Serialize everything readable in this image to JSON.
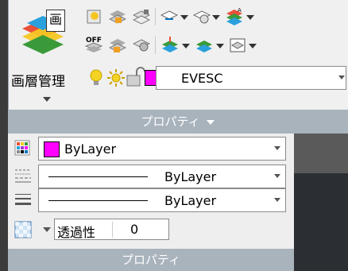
{
  "ribbon": {
    "layer_manager_label": "画層管理",
    "layer_current": "EVESC",
    "footer_label": "プロパティ",
    "layer_color": "#ff00ff"
  },
  "properties": {
    "color_value": "ByLayer",
    "color_swatch": "#ff00ff",
    "linetype_value": "ByLayer",
    "lineweight_value": "ByLayer",
    "transparency_label": "透過性",
    "transparency_value": "0",
    "footer_label": "プロパティ"
  },
  "icons": [
    "layer-stack-icon",
    "layer-freeze-icon",
    "layer-lock-icon",
    "layer-match-icon",
    "layer-previous-icon",
    "layer-isolate-icon",
    "layer-off-icon",
    "layer-unisolate-icon",
    "layer-walk-icon",
    "lightbulb-icon",
    "sun-icon",
    "unlock-icon",
    "color-palette-icon",
    "linetype-icon",
    "lineweight-icon",
    "transparency-icon"
  ]
}
